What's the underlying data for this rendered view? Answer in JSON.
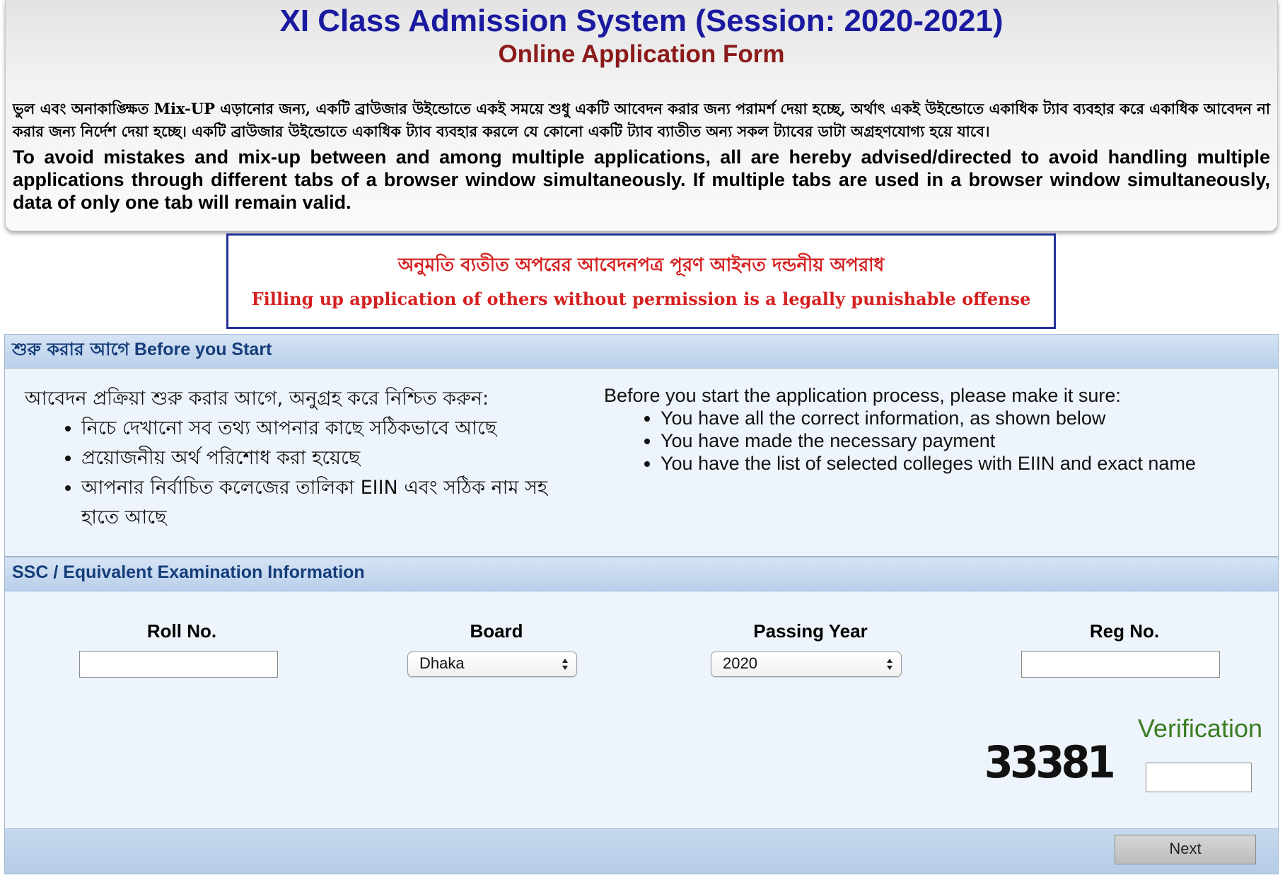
{
  "header": {
    "title": "XI Class Admission System (Session: 2020-2021)",
    "subtitle": "Online Application Form",
    "notice_bn": "ভুল এবং অনাকাঙ্ক্ষিত Mix-UP এড়ানোর জন্য, একটি ব্রাউজার উইন্ডোতে একই সময়ে শুধু একটি আবেদন করার জন্য পরামর্শ দেয়া হচ্ছে, অর্থাৎ একই উইন্ডোতে একাধিক ট্যাব ব্যবহার করে একাধিক আবেদন না করার জন্য নির্দেশ দেয়া হচ্ছে। একটি ব্রাউজার উইন্ডোতে একাধিক ট্যাব ব্যবহার করলে যে কোনো একটি ট্যাব ব্যাতীত অন্য সকল ট্যাবের ডাটা অগ্রহণযোগ্য হয়ে যাবে।",
    "notice_en": "To avoid mistakes and mix-up between and among multiple applications, all are hereby advised/directed to avoid handling multiple applications through different tabs of a browser window simultaneously. If multiple tabs are used in a browser window simultaneously, data of only one tab will remain valid."
  },
  "warning": {
    "bn": "অনুমতি ব্যতীত অপরের আবেদনপত্র পূরণ আইনত দন্ডনীয় অপরাধ",
    "en": "Filling up application of others without permission is a legally punishable offense"
  },
  "before_start": {
    "heading_bn": "শুরু করার আগে",
    "heading_en": "Before you Start",
    "intro_bn": "আবেদন প্রক্রিয়া শুরু করার আগে, অনুগ্রহ করে নিশ্চিত করুন:",
    "items_bn": [
      "নিচে দেখানো সব তথ্য আপনার কাছে সঠিকভাবে আছে",
      "প্রয়োজনীয় অর্থ পরিশোধ করা হয়েছে",
      "আপনার নির্বাচিত কলেজের তালিকা EIIN এবং সঠিক নাম সহ হাতে আছে"
    ],
    "intro_en": "Before you start the application process, please make it sure:",
    "items_en": [
      "You have all the correct information, as shown below",
      "You have made the necessary payment",
      "You have the list of selected colleges with EIIN and exact name"
    ]
  },
  "exam_info": {
    "heading": "SSC / Equivalent Examination Information",
    "roll_label": "Roll No.",
    "roll_value": "",
    "board_label": "Board",
    "board_value": "Dhaka",
    "year_label": "Passing Year",
    "year_value": "2020",
    "reg_label": "Reg No.",
    "reg_value": "",
    "verification_label": "Verification",
    "captcha": "33381",
    "verification_value": "",
    "next_label": "Next"
  },
  "icons": {
    "select_arrows": "up-down-chevron-icon"
  },
  "colors": {
    "title": "#1a1aa0",
    "subtitle": "#8b1a1a",
    "warning_text": "#d42020",
    "warning_border": "#23309a",
    "panel_heading": "#153d7a",
    "verification": "#3a7d21"
  }
}
